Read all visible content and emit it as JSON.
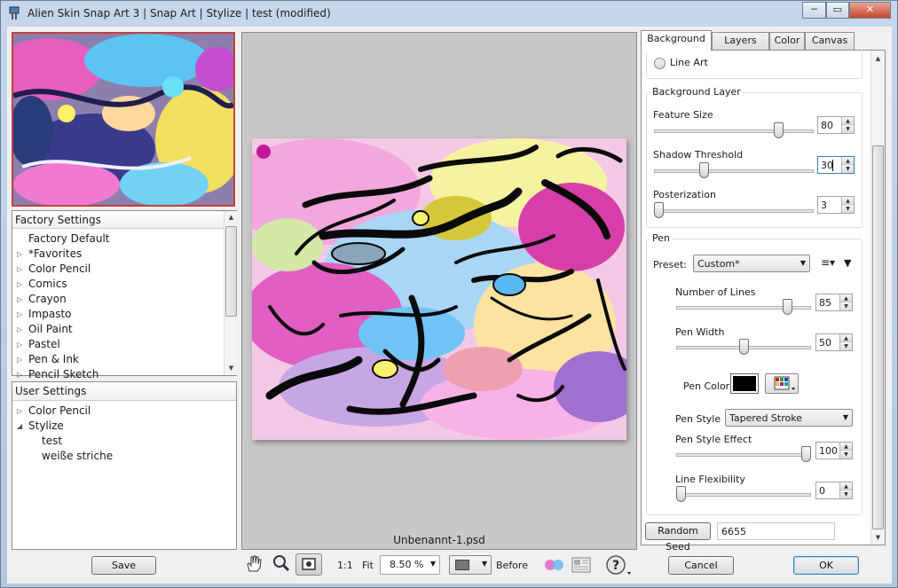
{
  "window": {
    "title": "Alien Skin Snap Art 3 | Snap Art | Stylize | test (modified)",
    "minimize": "─",
    "maximize": "▭",
    "close": "✕"
  },
  "factory": {
    "header": "Factory Settings",
    "items": [
      {
        "label": "Factory Default",
        "expandable": false
      },
      {
        "label": "*Favorites",
        "expandable": true
      },
      {
        "label": "Color Pencil",
        "expandable": true
      },
      {
        "label": "Comics",
        "expandable": true
      },
      {
        "label": "Crayon",
        "expandable": true
      },
      {
        "label": "Impasto",
        "expandable": true
      },
      {
        "label": "Oil Paint",
        "expandable": true
      },
      {
        "label": "Pastel",
        "expandable": true
      },
      {
        "label": "Pen & Ink",
        "expandable": true
      },
      {
        "label": "Pencil Sketch",
        "expandable": true
      }
    ]
  },
  "user": {
    "header": "User Settings",
    "items": [
      {
        "label": "Color Pencil",
        "level": 0,
        "arrow": "▷"
      },
      {
        "label": "Stylize",
        "level": 0,
        "arrow": "◢"
      },
      {
        "label": "test",
        "level": 1,
        "arrow": ""
      },
      {
        "label": "weiße striche",
        "level": 1,
        "arrow": ""
      }
    ]
  },
  "preview": {
    "filename": "Unbenannt-1.psd"
  },
  "tabs": [
    "Background",
    "Layers",
    "Color",
    "Canvas"
  ],
  "background": {
    "line_art_label": "Line Art",
    "layer_group": "Background Layer",
    "feature_size": {
      "label": "Feature Size",
      "value": "80",
      "fraction": 0.8
    },
    "shadow_threshold": {
      "label": "Shadow Threshold",
      "value": "30",
      "fraction": 0.3
    },
    "posterization": {
      "label": "Posterization",
      "value": "3",
      "fraction": 0.0
    }
  },
  "pen": {
    "group": "Pen",
    "preset_label": "Preset:",
    "preset_value": "Custom*",
    "number_of_lines": {
      "label": "Number of Lines",
      "value": "85",
      "fraction": 0.85
    },
    "pen_width": {
      "label": "Pen Width",
      "value": "50",
      "fraction": 0.5
    },
    "pen_color_label": "Pen Color",
    "pen_color": "#000000",
    "pen_style_label": "Pen Style",
    "pen_style_value": "Tapered Stroke",
    "pen_style_effect": {
      "label": "Pen Style Effect",
      "value": "100",
      "fraction": 1.0
    },
    "line_flexibility": {
      "label": "Line Flexibility",
      "value": "0",
      "fraction": 0.0
    }
  },
  "random_seed": {
    "button": "Random Seed",
    "value": "6655"
  },
  "bottom": {
    "save": "Save",
    "zoom_1_1": "1:1",
    "fit": "Fit",
    "zoom_value": "8.50 %",
    "before": "Before",
    "cancel": "Cancel",
    "ok": "OK"
  },
  "icons": {
    "hand": "hand-icon",
    "zoom": "magnifier-icon",
    "preview": "preview-frame-icon",
    "help": "help-icon"
  }
}
